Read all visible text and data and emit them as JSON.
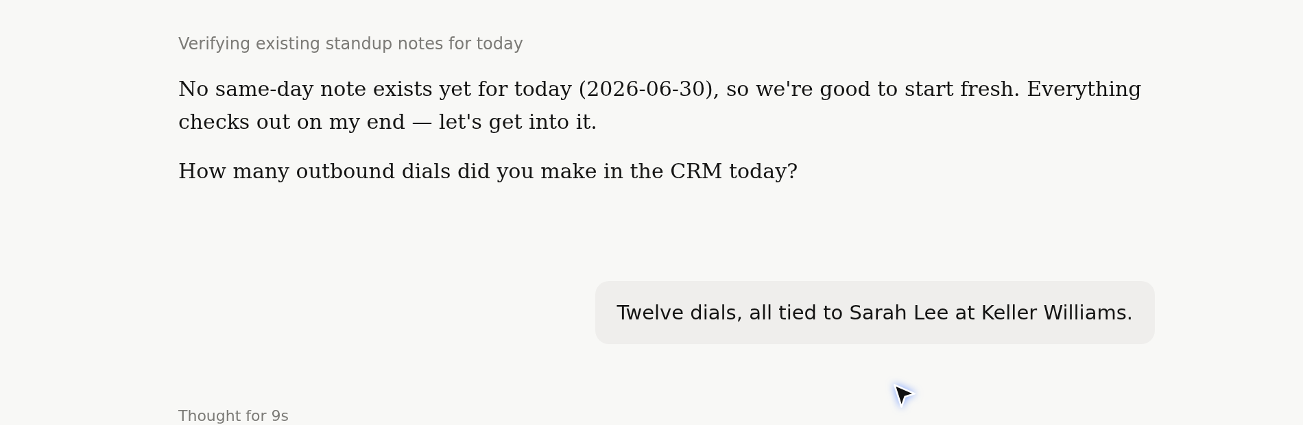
{
  "status_line": {
    "text": "Verifying existing standup notes for today"
  },
  "assistant_message": {
    "paragraphs": [
      "No same-day note exists yet for today (2026-06-30), so we're good to start fresh. Everything checks out on my end — let's get into it.",
      "How many outbound dials did you make in the CRM today?"
    ]
  },
  "user_message": {
    "text": "Twelve dials, all tied to Sarah Lee at Keller Williams."
  },
  "thought_label": {
    "text": "Thought for 9s"
  }
}
